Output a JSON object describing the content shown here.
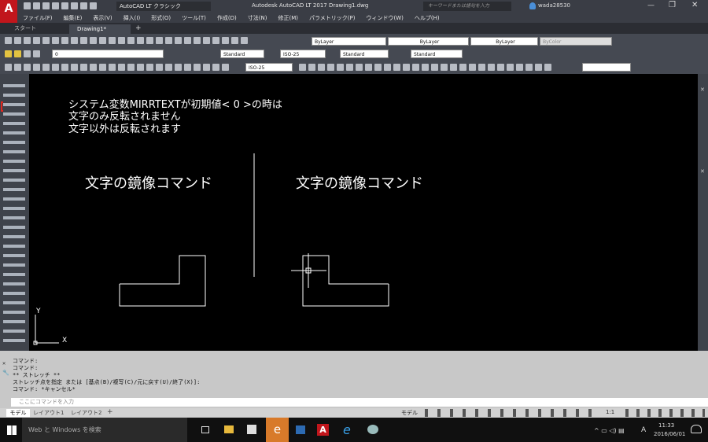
{
  "app": {
    "doc_title": "Autodesk AutoCAD LT 2017   Drawing1.dwg",
    "workspace": "AutoCAD LT クラシック",
    "search_placeholder": "キーワードまたは語句を入力",
    "user": "wada28530"
  },
  "menu": [
    "ファイル(F)",
    "編集(E)",
    "表示(V)",
    "挿入(I)",
    "形式(O)",
    "ツール(T)",
    "作成(D)",
    "寸法(N)",
    "修正(M)",
    "パラメトリック(P)",
    "ウィンドウ(W)",
    "ヘルプ(H)"
  ],
  "tabs": {
    "start": "スタート",
    "drawing": "Drawing1*"
  },
  "props": {
    "layer": "0",
    "color": "ByLayer",
    "linetype": "ByLayer",
    "lineweight": "ByLayer",
    "plotstyle": "ByColor"
  },
  "styles": {
    "text": "Standard",
    "dim": "ISO-25",
    "table": "Standard",
    "mleader": "Standard",
    "dim2": "ISO-25"
  },
  "canvas": {
    "note1": "システム変数MIRRTEXTが初期値< 0 >の時は",
    "note2": "文字のみ反転されません",
    "note3": "文字以外は反転されます",
    "left_label": "文字の鏡像コマンド",
    "right_label": "文字の鏡像コマンド",
    "ucs_x": "X",
    "ucs_y": "Y"
  },
  "command": {
    "lines": [
      "コマンド:",
      "コマンド:",
      "** ストレッチ **",
      "ストレッチ点を指定 または [基点(B)/複写(C)/元に戻す(U)/終了(X)]:",
      "コマンド: *キャンセル*"
    ],
    "input_placeholder": "ここにコマンドを入力"
  },
  "layouts": {
    "model": "モデル",
    "l1": "レイアウト1",
    "l2": "レイアウト2",
    "status_model": "モデル",
    "scale": "1:1"
  },
  "taskbar": {
    "search": "Web と Windows を検索",
    "time": "11:33",
    "date": "2016/06/01",
    "ime": "A"
  }
}
